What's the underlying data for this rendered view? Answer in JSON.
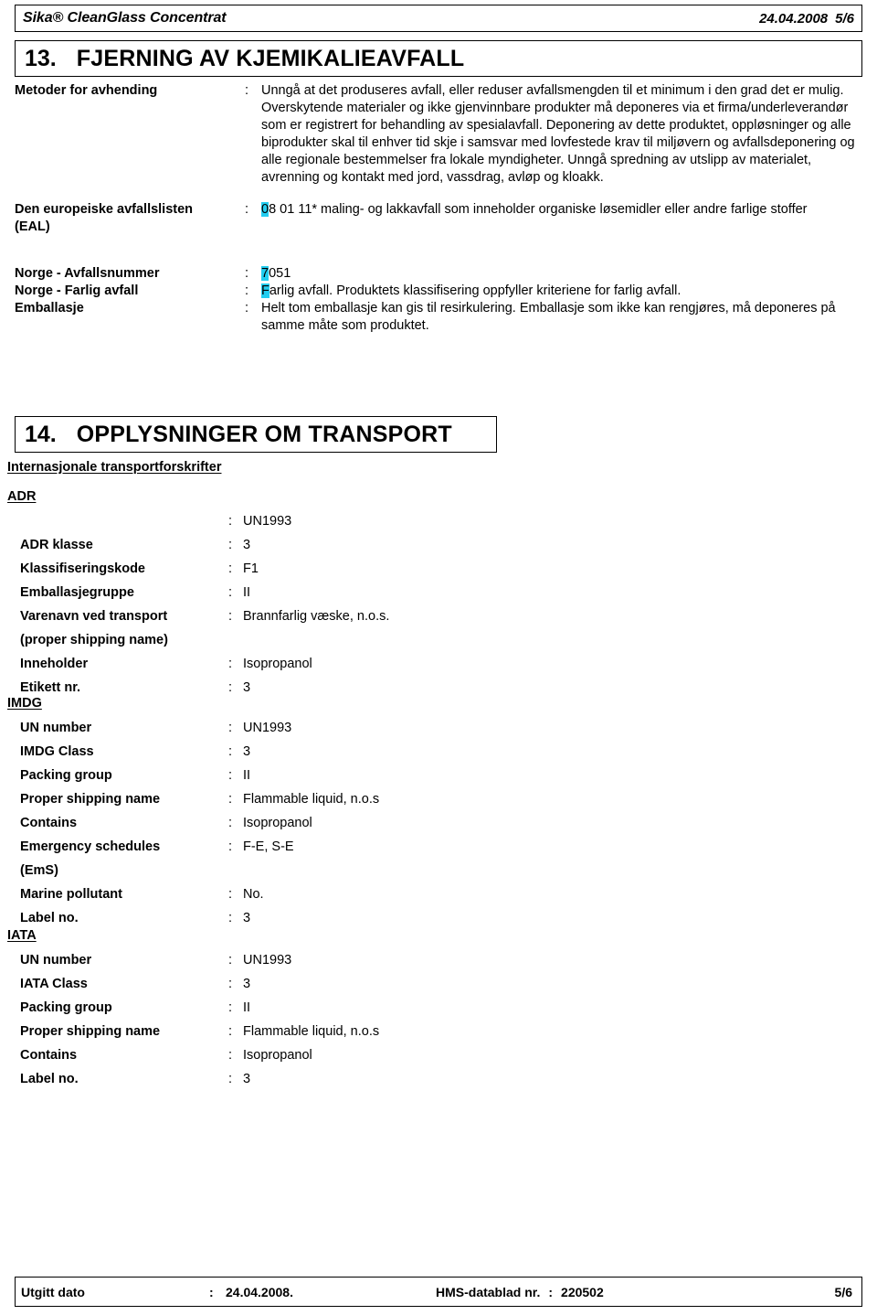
{
  "header": {
    "product": "Sika® CleanGlass Concentrat",
    "date": "24.04.2008",
    "page": "5/6"
  },
  "section13": {
    "number": "13.",
    "title": "FJERNING AV KJEMIKALIEAVFALL",
    "colon": ":",
    "rows": [
      {
        "label": "Metoder for avhending",
        "value": "Unngå at det produseres avfall, eller reduser avfallsmengden til et minimum i den grad det er mulig.  Overskytende materialer og ikke gjenvinnbare produkter må deponeres via et firma/underleverandør som er registrert for behandling av spesialavfall.  Deponering av dette produktet, oppløsninger og alle biprodukter skal til enhver tid skje i samsvar med lovfestede krav til miljøvern og avfallsdeponering og alle regionale bestemmelser fra lokale myndigheter.  Unngå spredning av utslipp av materialet, avrenning og kontakt med jord, vassdrag, avløp og kloakk."
      },
      {
        "label": "Den europeiske avfallslisten (EAL)",
        "label_line1": "Den europeiske avfallslisten",
        "label_line2": "(EAL)",
        "highlight": "0",
        "value": "8 01 11* maling- og lakkavfall som inneholder organiske løsemidler eller andre farlige stoffer"
      },
      {
        "label": "Norge  -  Avfallsnummer",
        "highlight": "7",
        "value": "051"
      },
      {
        "label": "Norge  - Farlig avfall",
        "highlight": "F",
        "value": "arlig avfall. Produktets klassifisering oppfyller kriteriene for farlig avfall."
      },
      {
        "label": "Emballasje",
        "highlight": "",
        "value": "Helt tom emballasje kan gis til resirkulering. Emballasje som ikke kan rengjøres, må deponeres på samme måte som produktet."
      }
    ]
  },
  "section14": {
    "number": "14.",
    "title": "OPPLYSNINGER OM TRANSPORT",
    "intl_heading": "Internasjonale transportforskrifter",
    "colon": ":",
    "adr": {
      "heading": "ADR",
      "rows": [
        {
          "label": "",
          "value": "UN1993"
        },
        {
          "label": "ADR klasse",
          "value": "3"
        },
        {
          "label": "Klassifiseringskode",
          "value": "F1"
        },
        {
          "label": "Emballasjegruppe",
          "value": "II"
        },
        {
          "label": "Varenavn ved transport",
          "label2": "(proper shipping name)",
          "value": "Brannfarlig væske, n.o.s."
        },
        {
          "label": "Inneholder",
          "value": "Isopropanol"
        },
        {
          "label": "Etikett nr.",
          "value": "3"
        }
      ]
    },
    "imdg": {
      "heading": "IMDG",
      "rows": [
        {
          "label": "UN number",
          "value": "UN1993"
        },
        {
          "label": "IMDG Class",
          "value": "3"
        },
        {
          "label": "Packing group",
          "value": "II"
        },
        {
          "label": "Proper shipping name",
          "value": "Flammable liquid, n.o.s"
        },
        {
          "label": "Contains",
          "value": "Isopropanol"
        },
        {
          "label": "Emergency schedules",
          "label2": "(EmS)",
          "value": "F-E, S-E"
        },
        {
          "label": "Marine pollutant",
          "value": "No."
        },
        {
          "label": "Label no.",
          "value": "3"
        }
      ]
    },
    "iata": {
      "heading": "IATA",
      "rows": [
        {
          "label": "UN number",
          "value": "UN1993"
        },
        {
          "label": "IATA Class",
          "value": "3"
        },
        {
          "label": "Packing group",
          "value": "II"
        },
        {
          "label": "Proper shipping name",
          "value": "Flammable liquid, n.o.s"
        },
        {
          "label": "Contains",
          "value": "Isopropanol"
        },
        {
          "label": "Label no.",
          "value": "3"
        }
      ]
    }
  },
  "footer": {
    "issued_label": "Utgitt dato",
    "colon": ":",
    "issued_date": "24.04.2008.",
    "sds_label": "HMS-datablad nr.",
    "sds_colon": ":",
    "sds_number": "220502",
    "page": "5/6"
  },
  "colors": {
    "highlight": "#22cdf0",
    "text": "#000000",
    "background": "#ffffff",
    "rule": "#000000"
  }
}
